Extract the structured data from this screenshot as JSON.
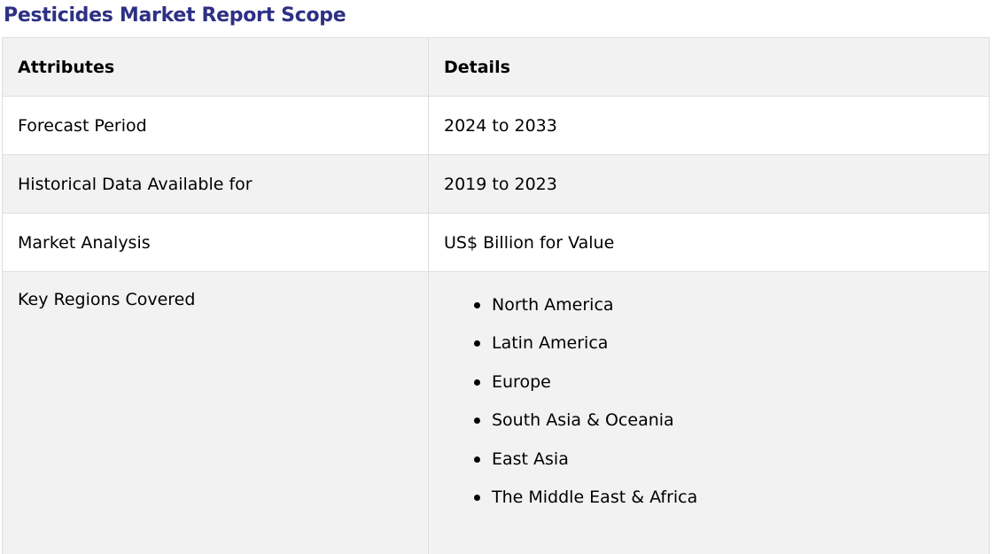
{
  "title": "Pesticides Market Report Scope",
  "colors": {
    "title": "#2d3083",
    "header_bg": "#f2f2f2",
    "stripe_bg": "#f2f2f2",
    "border": "#dedede"
  },
  "table": {
    "headers": [
      "Attributes",
      "Details"
    ],
    "rows": [
      {
        "attribute": "Forecast Period",
        "detail": "2024 to 2033"
      },
      {
        "attribute": "Historical Data Available for",
        "detail": "2019 to 2023"
      },
      {
        "attribute": "Market Analysis",
        "detail": "US$ Billion for Value"
      }
    ],
    "regions": {
      "attribute": "Key Regions Covered",
      "items": [
        "North America",
        "Latin America",
        "Europe",
        "South Asia & Oceania",
        "East Asia",
        "The Middle East & Africa"
      ]
    }
  }
}
